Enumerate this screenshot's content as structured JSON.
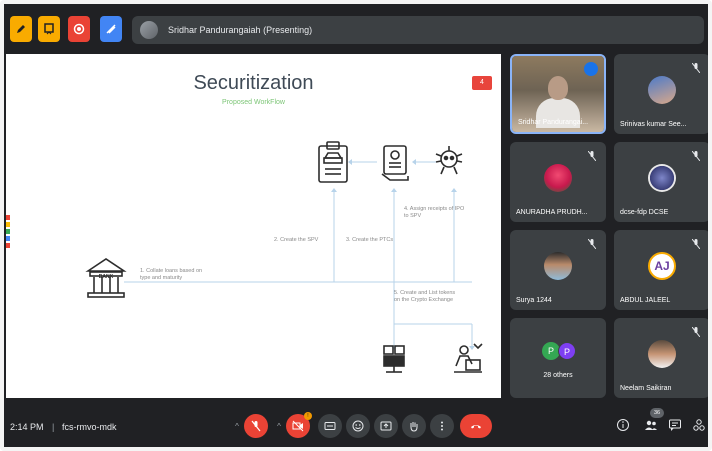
{
  "presenter_bar": {
    "label": "Sridhar Pandurangaiah (Presenting)"
  },
  "slide": {
    "title": "Securitization",
    "subtitle": "Proposed WorkFlow",
    "badge": "4",
    "bank_label": "BANK",
    "steps": {
      "s1": "1. Collate loans based on\ntype and maturity",
      "s2": "2. Create the SPV",
      "s3": "3. Create the PTCs",
      "s4": "4. Assign receipts of IPO\nto SPV",
      "s5": "5. Create and List tokens\non the Crypto Exchange"
    }
  },
  "participants": [
    {
      "name": "Sridhar Pandurangai...",
      "type": "video",
      "speaking": true
    },
    {
      "name": "Srinivas kumar See...",
      "muted": true
    },
    {
      "name": "ANURADHA PRUDH...",
      "muted": true
    },
    {
      "name": "dcse-fdp DCSE",
      "muted": true
    },
    {
      "name": "Surya 1244",
      "muted": true
    },
    {
      "name": "ABDUL JALEEL",
      "muted": true,
      "initials": "AJ"
    },
    {
      "name": "28 others",
      "avatars": [
        "P",
        "P"
      ]
    },
    {
      "name": "Neelam Saikiran",
      "muted": true
    }
  ],
  "bottom_bar": {
    "time": "2:14 PM",
    "separator": "|",
    "meeting_code": "fcs-rmvo-mdk",
    "participant_count": "36",
    "present_badge": "!"
  },
  "colors": {
    "bg": "#202124",
    "tile": "#3c4043",
    "red": "#ea4335",
    "green_sub": "#7cc576",
    "accent_blue": "#8ab4f8"
  }
}
